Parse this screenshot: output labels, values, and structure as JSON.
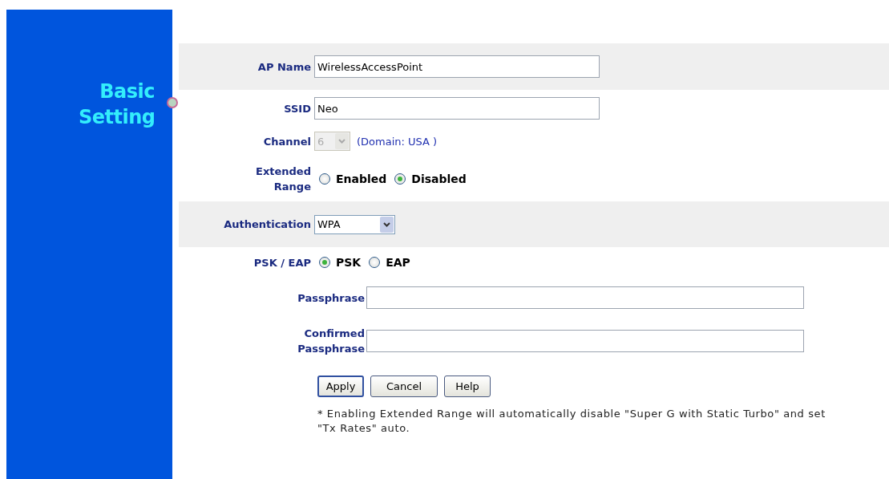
{
  "sidebar": {
    "title": "Basic Setting"
  },
  "fields": [
    {
      "kind": "text",
      "label": "AP Name",
      "value": "WirelessAccessPoint",
      "shaded": true
    },
    {
      "kind": "text",
      "label": "SSID",
      "value": "Neo",
      "shaded": false
    },
    {
      "kind": "select",
      "label": "Channel",
      "value": "6",
      "disabled": true,
      "shaded": false,
      "note": "(Domain: USA )"
    },
    {
      "kind": "radio",
      "label": "Extended Range",
      "shaded": false,
      "options": [
        {
          "label": "Enabled",
          "selected": false
        },
        {
          "label": "Disabled",
          "selected": true
        }
      ]
    },
    {
      "kind": "select",
      "label": "Authentication",
      "value": "WPA",
      "disabled": false,
      "shaded": true
    },
    {
      "kind": "radio",
      "label": "PSK / EAP",
      "shaded": false,
      "options": [
        {
          "label": "PSK",
          "selected": true
        },
        {
          "label": "EAP",
          "selected": false
        }
      ]
    },
    {
      "kind": "password",
      "label": "Passphrase",
      "shaded": false
    },
    {
      "kind": "password",
      "label": "Confirmed Passphrase",
      "shaded": false
    }
  ],
  "buttons": [
    {
      "label": "Apply",
      "default": true
    },
    {
      "label": "Cancel",
      "default": false
    },
    {
      "label": "Help",
      "default": false
    }
  ],
  "note": "* Enabling Extended Range will automatically disable \"Super G with Static Turbo\" and set \"Tx Rates\" auto."
}
